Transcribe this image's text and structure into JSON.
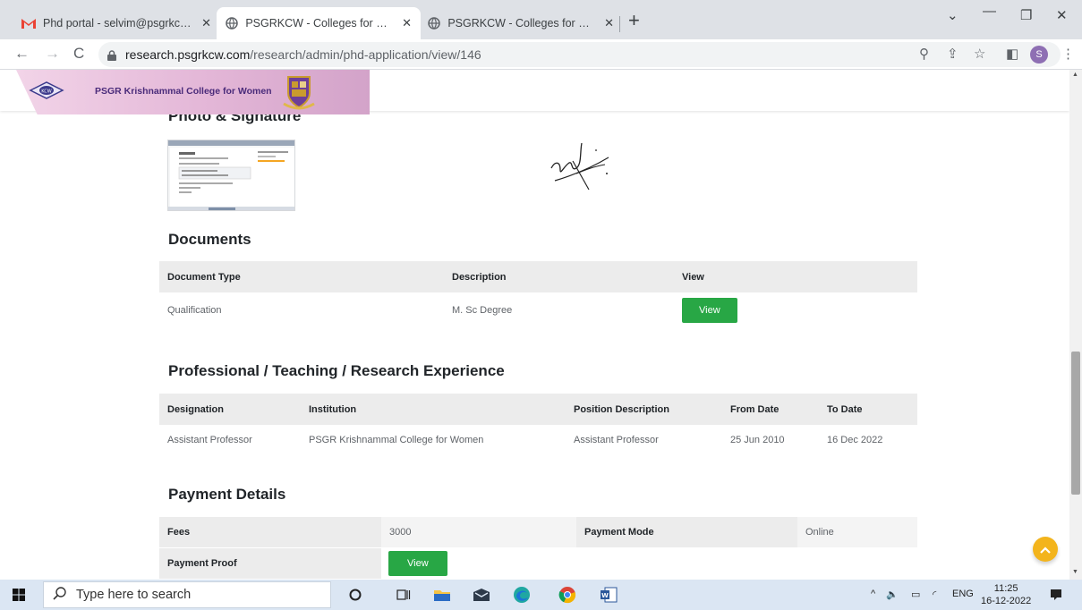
{
  "browser": {
    "tabs": [
      {
        "title": "Phd portal - selvim@psgrkcw.ac.i",
        "favicon": "gmail-icon",
        "active": false
      },
      {
        "title": "PSGRKCW - Colleges for women",
        "favicon": "globe-icon",
        "active": true
      },
      {
        "title": "PSGRKCW - Colleges for women",
        "favicon": "globe-icon",
        "active": false
      }
    ],
    "url_host": "research.psgrkcw.com",
    "url_path": "/research/admin/phd-application/view/146",
    "profile_initial": "S"
  },
  "site": {
    "brand_name": "PSGR Krishnammal College for Women"
  },
  "photo_signature": {
    "heading": "Photo & Signature"
  },
  "documents": {
    "heading": "Documents",
    "columns": [
      "Document Type",
      "Description",
      "View"
    ],
    "rows": [
      {
        "type": "Qualification",
        "description": "M. Sc Degree",
        "action": "View"
      }
    ]
  },
  "experience": {
    "heading": "Professional / Teaching / Research Experience",
    "columns": [
      "Designation",
      "Institution",
      "Position Description",
      "From Date",
      "To Date"
    ],
    "rows": [
      {
        "designation": "Assistant Professor",
        "institution": "PSGR Krishnammal College for Women",
        "position": "Assistant Professor",
        "from": "25 Jun 2010",
        "to": "16 Dec 2022"
      }
    ]
  },
  "payment": {
    "heading": "Payment Details",
    "fees_label": "Fees",
    "fees_value": "3000",
    "mode_label": "Payment Mode",
    "mode_value": "Online",
    "proof_label": "Payment Proof",
    "proof_action": "View"
  },
  "taskbar": {
    "search_placeholder": "Type here to search",
    "language": "ENG",
    "time": "11:25",
    "date": "16-12-2022"
  },
  "colors": {
    "accent_green": "#28a745",
    "back_to_top": "#f3b41c",
    "brand_purple": "#4a2b7a"
  }
}
